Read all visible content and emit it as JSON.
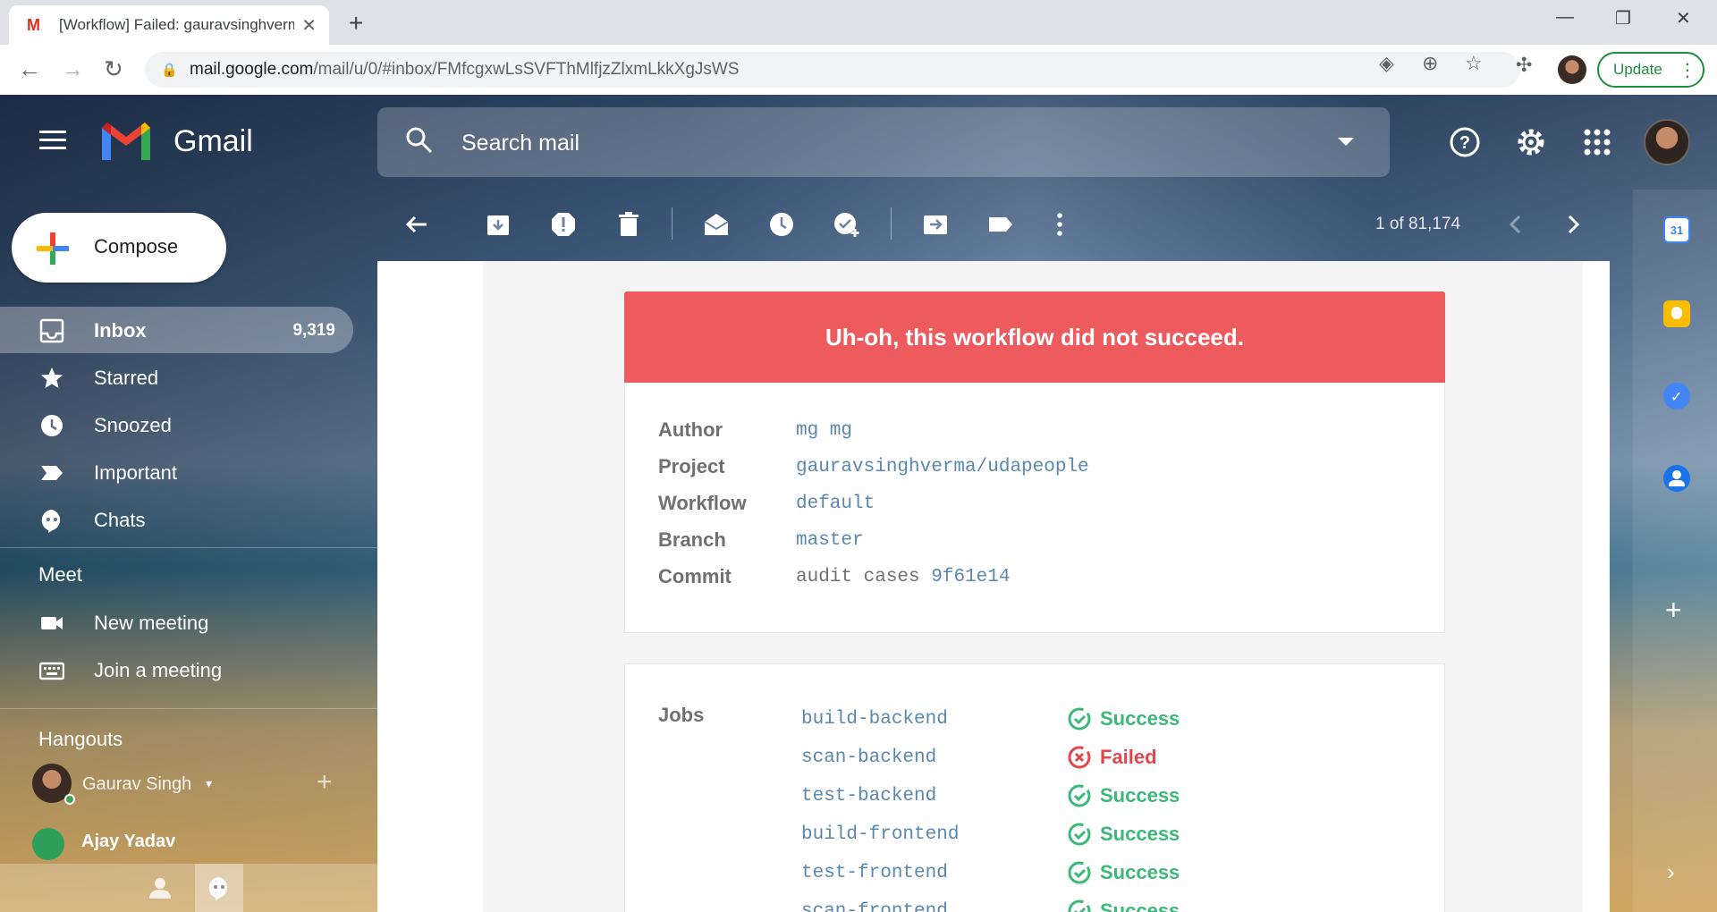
{
  "browser": {
    "tab_title": "[Workflow] Failed: gauravsinghverma/udapeople",
    "url_host": "mail.google.com",
    "url_path": "/mail/u/0/#inbox/FMfcgxwLsSVFThMlfjzZlxmLkkXgJsWS",
    "update_label": "Update"
  },
  "gmail": {
    "brand": "Gmail",
    "search_placeholder": "Search mail",
    "compose_label": "Compose",
    "nav": [
      {
        "label": "Inbox",
        "count": "9,319"
      },
      {
        "label": "Starred"
      },
      {
        "label": "Snoozed"
      },
      {
        "label": "Important"
      },
      {
        "label": "Chats"
      }
    ],
    "meet": {
      "title": "Meet",
      "items": [
        {
          "label": "New meeting"
        },
        {
          "label": "Join a meeting"
        }
      ]
    },
    "hangouts": {
      "title": "Hangouts",
      "contacts": [
        {
          "name": "Gaurav Singh"
        },
        {
          "name": "Ajay Yadav"
        }
      ]
    },
    "pager": "1 of 81,174"
  },
  "email": {
    "banner": "Uh-oh, this workflow did not succeed.",
    "details": {
      "author_key": "Author",
      "author": "mg mg",
      "project_key": "Project",
      "project": "gauravsinghverma/udapeople",
      "workflow_key": "Workflow",
      "workflow": "default",
      "branch_key": "Branch",
      "branch": "master",
      "commit_key": "Commit",
      "commit_msg": "audit cases",
      "commit_hash": "9f61e14"
    },
    "jobs_label": "Jobs",
    "jobs": [
      {
        "name": "build-backend",
        "status": "Success"
      },
      {
        "name": "scan-backend",
        "status": "Failed"
      },
      {
        "name": "test-backend",
        "status": "Success"
      },
      {
        "name": "build-frontend",
        "status": "Success"
      },
      {
        "name": "test-frontend",
        "status": "Success"
      },
      {
        "name": "scan-frontend",
        "status": "Success"
      }
    ]
  },
  "colors": {
    "banner_red": "#ed5b5f",
    "success_green": "#3cb878",
    "failed_red": "#e0474c",
    "link_blue": "#5a87b0"
  }
}
